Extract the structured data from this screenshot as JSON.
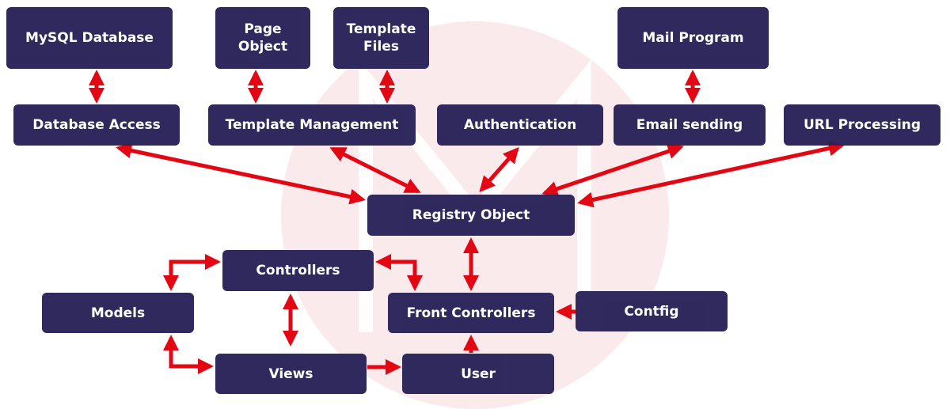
{
  "colors": {
    "box": "#2a2359",
    "arrow": "#e30613",
    "watermark": "#fbeaec"
  },
  "nodes": {
    "mysql": "MySQL Database",
    "page_object": "Page Object",
    "template_files": "Template Files",
    "mail_program": "Mail Program",
    "database_access": "Database Access",
    "template_management": "Template Management",
    "authentication": "Authentication",
    "email_sending": "Email sending",
    "url_processing": "URL Processing",
    "registry": "Registry Object",
    "controllers": "Controllers",
    "models": "Models",
    "front_controllers": "Front Controllers",
    "config": "Contfig",
    "views": "Views",
    "user": "User"
  }
}
